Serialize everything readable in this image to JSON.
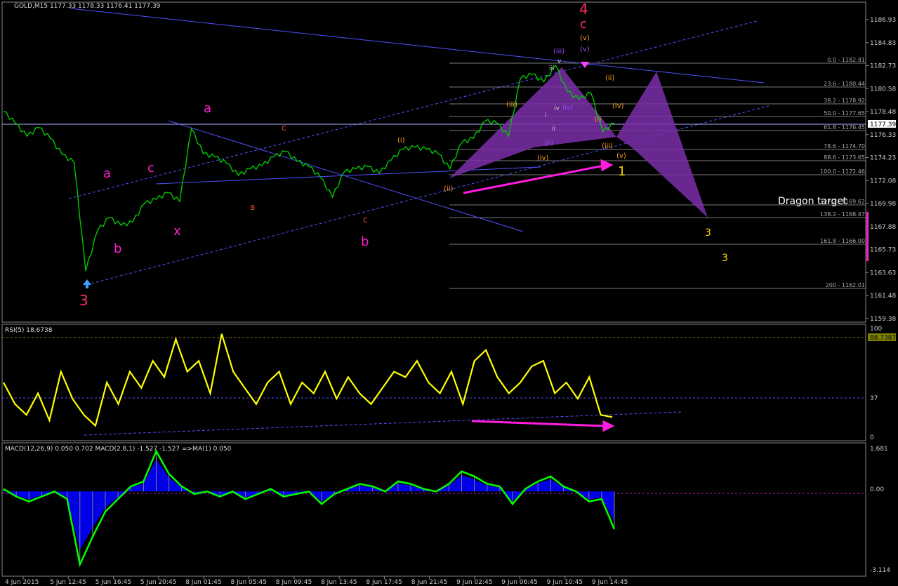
{
  "window": {
    "header": "GOLD,M15  1177.33 1178.33 1176.41 1177.39",
    "rsi_header": "RSI(5) 18.6738",
    "macd_header": "MACD(12,26,9) 0.050 0.702  MACD(2,8,1) -1.527 -1.527  =>MA(1) 0.050"
  },
  "price_axis": [
    "1186.93",
    "1184.83",
    "1182.73",
    "1180.58",
    "1178.48",
    "1176.33",
    "1174.23",
    "1172.08",
    "1169.98",
    "1167.88",
    "1165.73",
    "1163.63",
    "1161.48",
    "1159.38"
  ],
  "current_price": "1177.39",
  "rsi_axis": {
    "top": "100",
    "mid": "37",
    "bottom": "0",
    "current": "88.7387"
  },
  "macd_axis": {
    "top": "1.681",
    "zero": "0.00",
    "bottom": "-3.114"
  },
  "time_axis": [
    "4 Jun 2015",
    "5 Jun 12:45",
    "5 Jun 16:45",
    "5 Jun 20:45",
    "8 Jun 01:45",
    "8 Jun 05:45",
    "8 Jun 09:45",
    "8 Jun 13:45",
    "8 Jun 17:45",
    "8 Jun 21:45",
    "9 Jun 02:45",
    "9 Jun 06:45",
    "9 Jun 10:45",
    "9 Jun 14:45"
  ],
  "fib_levels": [
    "0.0 - 1182.91",
    "23.6 - 1180.44",
    "38.2 - 1178.92",
    "50.0 - 1177.65",
    "61.8 - 1176.45",
    "78.6 - 1174.70",
    "88.6 - 1173.65",
    "100.0 - 1172.46",
    "127.2 - 1169.62",
    "138.2 - 1168.47",
    "161.8 - 1166.00",
    "200 - 1162.01"
  ],
  "dragon_label": "Dragon target",
  "wave_labels": {
    "w3_main": "3",
    "w4_main": "4",
    "c_main": "c",
    "v_main": "(v)",
    "a_left": "a",
    "b_left": "b",
    "c_left": "c",
    "x_left": "x",
    "a_mid": "a",
    "b_mid": "b",
    "a_small": "a",
    "c_small": "c",
    "i_small": "(i)",
    "ii_small": "(ii)",
    "iii_small": "(iii)",
    "iv_small": "(iv)",
    "iii_top": "(iii)",
    "v_top": "(v)",
    "ii_top": "(ii)",
    "i_right": "(i)",
    "iv_right": "(iv)",
    "iii_right": "(iii)",
    "v_right": "(v)",
    "one": "1",
    "three_a": "3",
    "three_b": "3",
    "r_i": "i",
    "r_ii": "ii",
    "r_iii": "iii",
    "r_iv": "iv",
    "r_v": "v",
    "p_iv": "(iv)",
    "p_ii": "(ii)"
  },
  "colors": {
    "price": "#00c800",
    "rsi": "#ffff00",
    "macd_line": "#00ff00",
    "macd_hist": "#0000ff",
    "signal": "#ff00ff",
    "fib": "#808080",
    "channel": "#5050ff",
    "pattern": "#7a2fa8"
  },
  "chart_data": [
    {
      "type": "line",
      "title": "GOLD,M15",
      "ylim": [
        1159.38,
        1186.93
      ],
      "series": [
        {
          "values": [
            1178.5,
            1177.4,
            1176.2,
            1177.0,
            1176.0,
            1174.5,
            1173.8,
            1163.8,
            1167.5,
            1168.7,
            1168.0,
            1168.3,
            1170.0,
            1170.4,
            1171.0,
            1170.2,
            1176.9,
            1174.6,
            1174.3,
            1173.7,
            1172.6,
            1173.2,
            1173.5,
            1174.3,
            1174.8,
            1173.9,
            1173.4,
            1172.4,
            1170.6,
            1172.9,
            1173.2,
            1173.4,
            1172.8,
            1174.0,
            1175.0,
            1175.2,
            1175.0,
            1174.6,
            1173.2,
            1175.6,
            1176.0,
            1177.6,
            1177.4,
            1176.2,
            1181.5,
            1181.9,
            1181.2,
            1182.7,
            1180.3,
            1179.6,
            1180.2,
            1176.6,
            1177.4
          ]
        }
      ]
    },
    {
      "type": "line",
      "title": "RSI(5) 18.6738",
      "ylim": [
        0,
        100
      ],
      "series": [
        {
          "values": [
            50,
            30,
            20,
            40,
            15,
            60,
            35,
            20,
            10,
            50,
            30,
            60,
            45,
            70,
            55,
            90,
            60,
            70,
            40,
            95,
            60,
            45,
            30,
            50,
            60,
            30,
            50,
            40,
            60,
            35,
            55,
            40,
            30,
            45,
            60,
            55,
            70,
            50,
            40,
            60,
            30,
            70,
            80,
            55,
            40,
            50,
            65,
            70,
            40,
            50,
            35,
            55,
            20,
            18
          ]
        }
      ]
    },
    {
      "type": "bar",
      "title": "MACD(12,26,9) 0.050 0.702  MACD(2,8,1) -1.527 -1.527",
      "ylim": [
        -3.114,
        1.681
      ],
      "series": [
        {
          "values": [
            0.1,
            -0.2,
            -0.4,
            -0.2,
            0.0,
            -0.3,
            -2.9,
            -1.8,
            -0.8,
            -0.3,
            0.2,
            0.4,
            1.6,
            0.7,
            0.2,
            -0.1,
            0.0,
            -0.2,
            0.0,
            -0.3,
            -0.1,
            0.1,
            -0.2,
            -0.1,
            0.0,
            -0.5,
            -0.1,
            0.1,
            0.3,
            0.2,
            0.0,
            0.4,
            0.3,
            0.1,
            0.0,
            0.3,
            0.8,
            0.6,
            0.3,
            0.2,
            -0.5,
            0.1,
            0.4,
            0.6,
            0.2,
            0.0,
            -0.4,
            -0.3,
            -1.5
          ]
        }
      ]
    }
  ]
}
